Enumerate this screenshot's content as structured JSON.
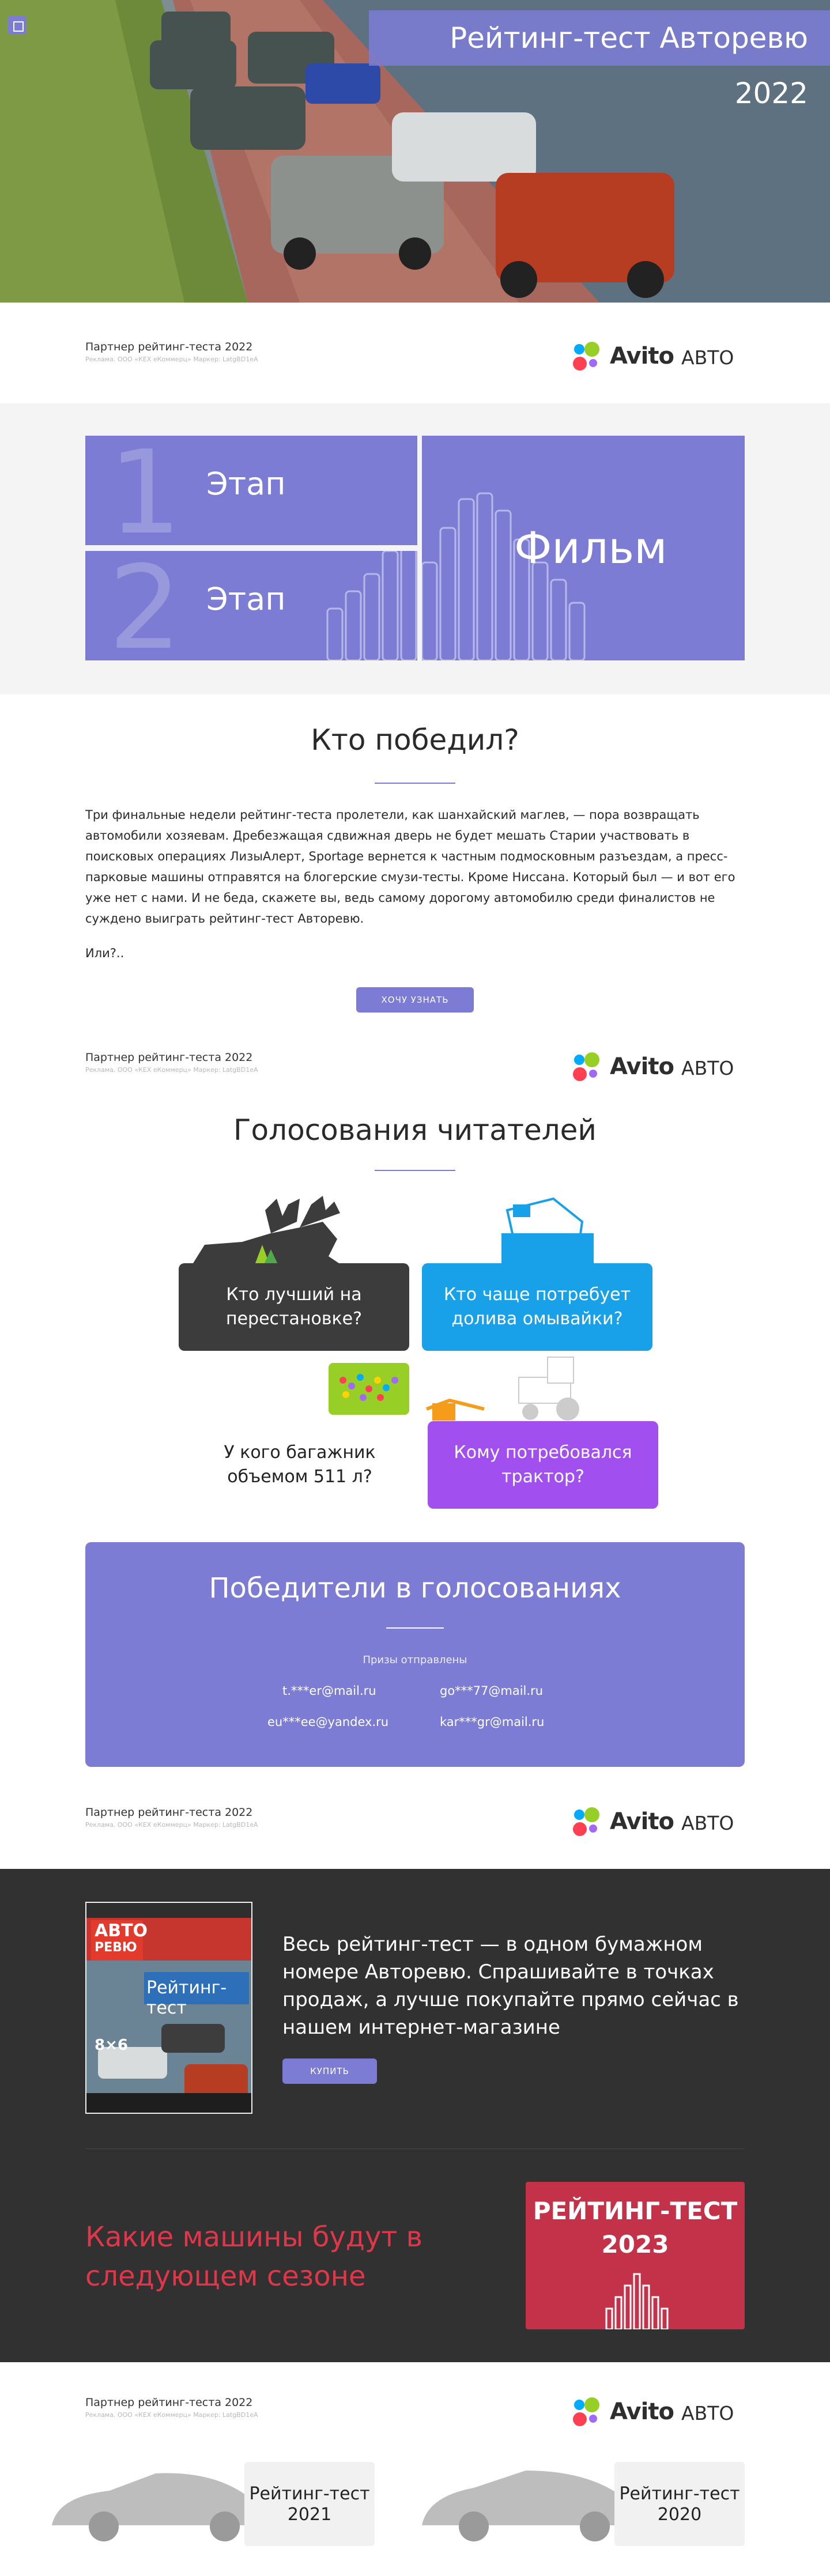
{
  "hero": {
    "title": "Рейтинг-тест Авторевю 2022",
    "logo_icon": "square-logo-icon"
  },
  "partner": {
    "title": "Партнер рейтинг-теста 2022",
    "subtitle": "Реклама. ООО «КЕХ еКоммерц» Маркер: LatgBD1eA",
    "brand": "Avito",
    "brand_sub": "АВТО",
    "colors": [
      "#0af",
      "#97cf26",
      "#ff4053",
      "#a169f7"
    ]
  },
  "stages": {
    "stage1_num": "1",
    "stage1_label": "Этап",
    "stage2_num": "2",
    "stage2_label": "Этап",
    "film_label": "Фильм",
    "accent": "#7c7cd4"
  },
  "winner": {
    "heading": "Кто победил?",
    "paragraph": "Три финальные недели рейтинг-теста пролетели, как шанхайский маглев, — пора возвращать автомобили хозяевам. Дребезжащая сдвижная дверь не будет мешать Старии участвовать в поисковых операциях ЛизыАлерт, Sportage вернется к частным подмосковным разъездам, а пресс-парковые машины отправятся на блогерские смузи-тесты. Кроме Ниссана. Который был — и вот его уже нет с нами. И не беда, скажете вы, ведь самому дорогому автомобилю среди финалистов не суждено выиграть рейтинг-тест Авторевю.",
    "tail": "Или?..",
    "button": "ХОЧУ УЗНАТЬ"
  },
  "votes": {
    "heading": "Голосования читателей",
    "card1": "Кто лучший на перестановке?",
    "card2": "Кто чаще потребует долива омывайки?",
    "card3": "У кого багажник объемом 511 л?",
    "card4": "Кому потребовался трактор?"
  },
  "winners": {
    "title": "Победители в голосованиях",
    "subtitle": "Призы отправлены",
    "emails": [
      "t.***er@mail.ru",
      "go***77@mail.ru",
      "eu***ee@yandex.ru",
      "kar***gr@mail.ru"
    ]
  },
  "magazine": {
    "masthead_top": "АВТО",
    "masthead_bottom": "РЕВЮ",
    "cover_title": "Рейтинг-тест",
    "cover_num": "8×6",
    "text": "Весь рейтинг-тест — в одном бумажном номере Авторевю. Спрашивайте в точках продаж, а лучше покупайте прямо сейчас в нашем интернет-магазине",
    "button": "КУПИТЬ"
  },
  "next_season": {
    "text": "Какие машины будут в следующем сезоне",
    "badge_line1": "РЕЙТИНГ-ТЕСТ",
    "badge_line2": "2023"
  },
  "previous": {
    "card1": "Рейтинг-тест 2021",
    "card2": "Рейтинг-тест 2020"
  }
}
